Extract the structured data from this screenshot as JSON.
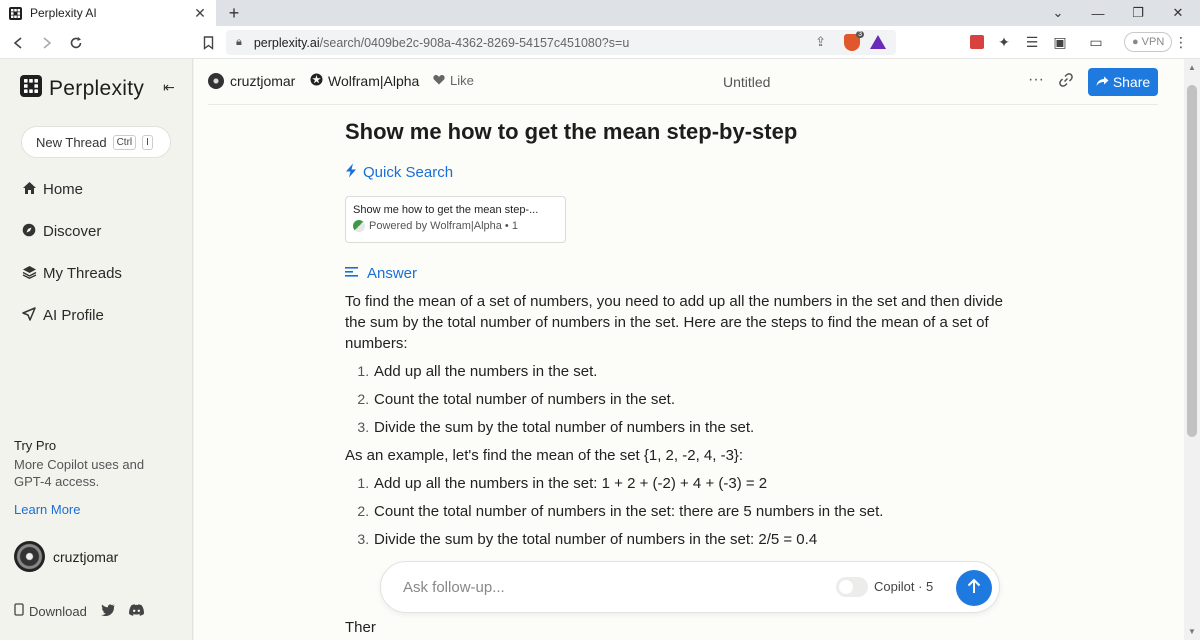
{
  "browser": {
    "tab_title": "Perplexity AI",
    "url_host": "perplexity.ai",
    "url_path": "/search/0409be2c-908a-4362-8269-54157c451080?s=u",
    "shield_count": "3",
    "vpn_label": "VPN"
  },
  "sidebar": {
    "brand": "Perplexity",
    "new_thread_label": "New Thread",
    "shortcut_keys": [
      "Ctrl",
      "I"
    ],
    "nav": [
      {
        "label": "Home",
        "icon": "home-icon"
      },
      {
        "label": "Discover",
        "icon": "compass-icon"
      },
      {
        "label": "My Threads",
        "icon": "layers-icon"
      },
      {
        "label": "AI Profile",
        "icon": "send-icon"
      }
    ],
    "try_pro_title": "Try Pro",
    "try_pro_desc": "More Copilot uses and GPT-4 access.",
    "learn_more": "Learn More",
    "username": "cruztjomar",
    "download_label": "Download"
  },
  "header": {
    "author": "cruztjomar",
    "wolfram": "Wolfram|Alpha",
    "like": "Like",
    "title": "Untitled",
    "share": "Share"
  },
  "thread": {
    "question": "Show me how to get the mean step-by-step",
    "quick_search": "Quick Search",
    "source": {
      "title": "Show me how to get the mean step-...",
      "subtitle": "Powered by Wolfram|Alpha • 1"
    },
    "answer_heading": "Answer",
    "answer_intro": "To find the mean of a set of numbers, you need to add up all the numbers in the set and then divide the sum by the total number of numbers in the set. Here are the steps to find the mean of a set of numbers:",
    "steps": [
      "Add up all the numbers in the set.",
      "Count the total number of numbers in the set.",
      "Divide the sum by the total number of numbers in the set."
    ],
    "example_intro": "As an example, let's find the mean of the set {1, 2, -2, 4, -3}:",
    "example_steps": [
      "Add up all the numbers in the set: 1 + 2 + (-2) + 4 + (-3) = 2",
      "Count the total number of numbers in the set: there are 5 numbers in the set.",
      "Divide the sum by the total number of numbers in the set: 2/5 = 0.4"
    ],
    "truncated_line": "Ther"
  },
  "followup": {
    "placeholder": "Ask follow-up...",
    "copilot_label": "Copilot · 5"
  },
  "colors": {
    "accent": "#1f7ae0",
    "link": "#1a6fd6",
    "sidebar_bg": "#f3f3ee"
  }
}
